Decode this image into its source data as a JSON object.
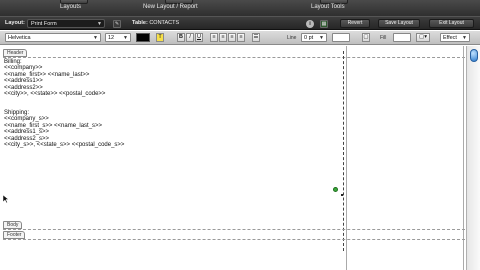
{
  "top_menu": {
    "layouts_label": "Layouts",
    "new_layout_label": "New Layout / Report",
    "layout_tools_label": "Layout Tools"
  },
  "layout_bar": {
    "layout_label": "Layout:",
    "layout_value": "Print Form",
    "table_label": "Table:",
    "table_value": "CONTACTS",
    "info_icon": "i",
    "revert_label": "Revert",
    "save_layout_label": "Save Layout",
    "exit_layout_label": "Exit Layout"
  },
  "format_bar": {
    "font_value": "Helvetica",
    "size_value": "12",
    "bold": "B",
    "italic": "I",
    "underline": "U",
    "highlight": "T",
    "line_label": "Line",
    "line_value": "0 pt",
    "fill_label": "Fill",
    "effect_value": "Effect"
  },
  "parts": {
    "header_label": "Header",
    "body_label": "Body",
    "footer_label": "Footer"
  },
  "billing_block": {
    "lines": [
      "Billing:",
      "<<company>>",
      "<<name_first>> <<name_last>>",
      "<<address1>>",
      "<<address2>>",
      "<<city>>, <<state>> <<postal_code>>"
    ]
  },
  "shipping_block": {
    "lines": [
      "Shipping:",
      "<<company_s>>",
      "<<name_first_s>> <<name_last_s>>",
      "<<address1_s>>",
      "<<address2_s>>",
      "<<city_s>>, <<state_s>> <<postal_code_s>>"
    ]
  },
  "colors": {
    "toolbar_dark": "#2f2f2f",
    "format_bar": "#cfcfcf",
    "highlight_button": "#f7e04a",
    "handle_green": "#3aa83a",
    "scroll_thumb": "#2f7ecf"
  }
}
